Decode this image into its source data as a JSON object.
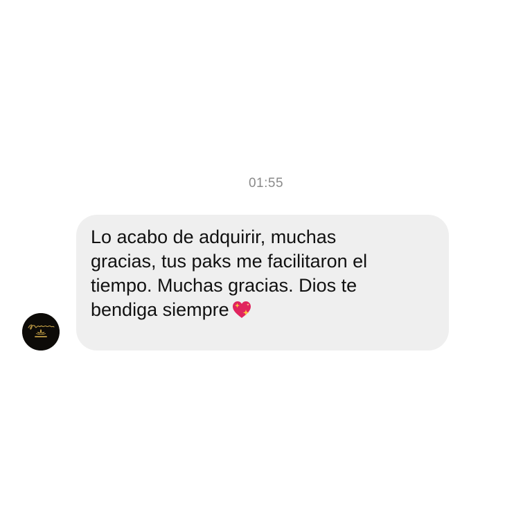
{
  "chat": {
    "timestamp": "01:55",
    "message": {
      "text": "Lo acabo de adquirir, muchas\ngracias, tus paks me facilitaron el\ntiempo. Muchas gracias. Dios te\nbendiga siempre",
      "emoji": "sparkling-heart-icon"
    },
    "sender": {
      "avatar_logo_text": "Paula makeup"
    }
  },
  "colors": {
    "bubble": "#efefef",
    "timestamp": "#8a8a8a",
    "text": "#111111",
    "heart": "#e0245e",
    "sparkle": "#ffc83d",
    "avatar_bg": "#0d0b08",
    "avatar_gold": "#c9a449"
  }
}
